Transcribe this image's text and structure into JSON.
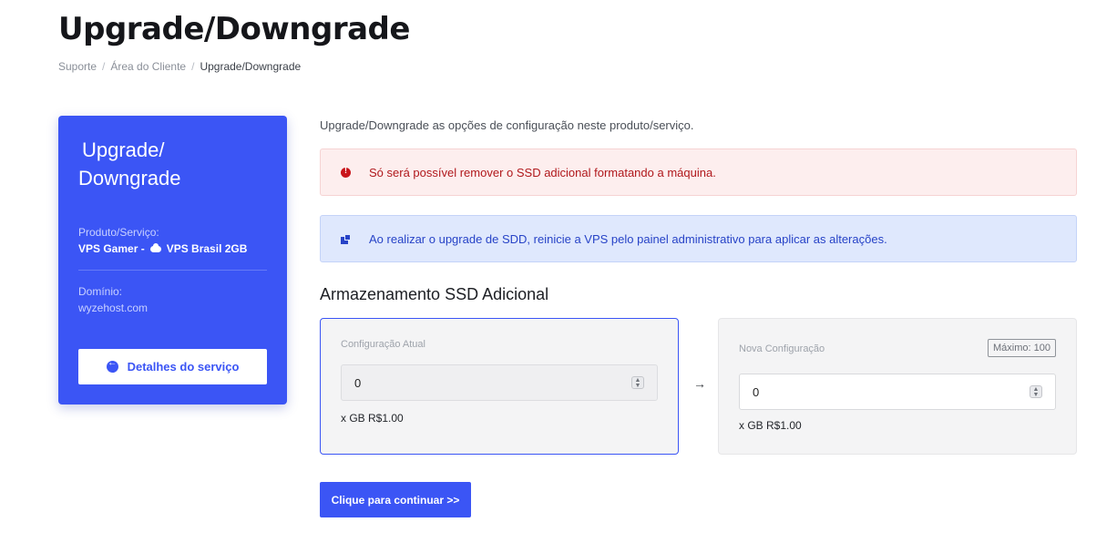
{
  "page": {
    "title": "Upgrade/Downgrade"
  },
  "breadcrumb": {
    "items": [
      "Suporte",
      "Área do Cliente",
      "Upgrade/Downgrade"
    ],
    "separator": "/"
  },
  "sidebar": {
    "title_line1": "Upgrade/",
    "title_line2": "Downgrade",
    "product_label": "Produto/Serviço:",
    "product_value_1": "VPS Gamer -",
    "product_value_2": "VPS Brasil 2GB",
    "domain_label": "Domínio:",
    "domain_value": "wyzehost.com",
    "details_button": "Detalhes do serviço"
  },
  "main": {
    "intro": "Upgrade/Downgrade as opções de configuração neste produto/serviço.",
    "alert_danger": "Só será possível remover o SSD adicional formatando a máquina.",
    "alert_info": "Ao realizar o upgrade de SDD, reinicie a VPS pelo painel administrativo para aplicar as alterações.",
    "section_heading": "Armazenamento SSD Adicional",
    "current": {
      "label": "Configuração Atual",
      "value": "0",
      "price": "x GB R$1.00"
    },
    "new": {
      "label": "Nova Configuração",
      "value": "0",
      "price": "x GB R$1.00",
      "max_badge": "Máximo: 100"
    },
    "continue_button": "Clique para continuar >>"
  },
  "colors": {
    "primary": "#3b55f5",
    "danger_text": "#b0181c",
    "danger_bg": "#fdeeee",
    "info_text": "#2743c7",
    "info_bg": "#dfe8fd"
  }
}
